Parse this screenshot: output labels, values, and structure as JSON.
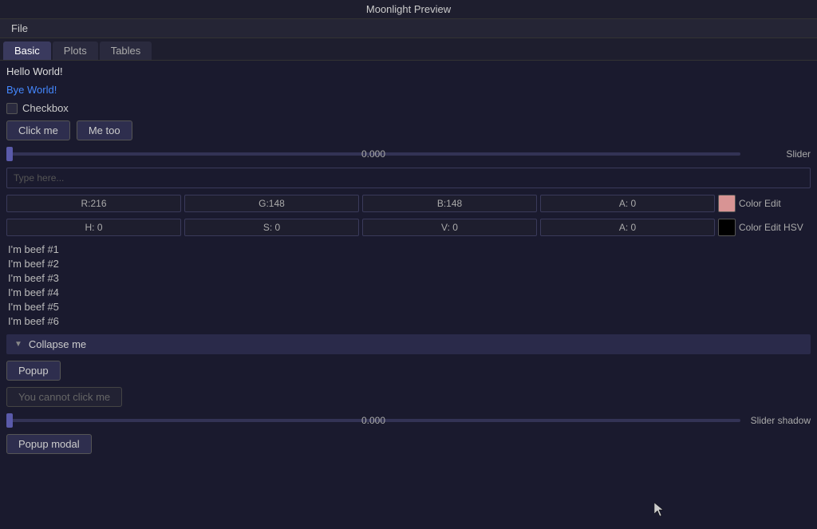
{
  "titlebar": {
    "title": "Moonlight Preview"
  },
  "menubar": {
    "file_label": "File"
  },
  "tabs": {
    "items": [
      {
        "label": "Basic",
        "active": true
      },
      {
        "label": "Plots",
        "active": false
      },
      {
        "label": "Tables",
        "active": false
      }
    ]
  },
  "content": {
    "hello": "Hello World!",
    "bye": "Bye World!",
    "checkbox_label": "Checkbox",
    "btn_click_me": "Click me",
    "btn_me_too": "Me too",
    "slider1": {
      "value": "0.000",
      "label": "Slider"
    },
    "text_input_placeholder": "Type here...",
    "color_edit": {
      "r": "R:216",
      "g": "G:148",
      "b": "B:148",
      "a": "A: 0",
      "label": "Color Edit",
      "swatch_color": "#d89494"
    },
    "color_edit_hsv": {
      "h": "H: 0",
      "s": "S: 0",
      "v": "V: 0",
      "a": "A: 0",
      "label": "Color Edit HSV",
      "swatch_color": "#000000"
    },
    "list_items": [
      "I'm beef #1",
      "I'm beef #2",
      "I'm beef #3",
      "I'm beef #4",
      "I'm beef #5",
      "I'm beef #6"
    ],
    "collapse_label": "Collapse me",
    "popup_label": "Popup",
    "disabled_btn_label": "You cannot click me",
    "slider2": {
      "value": "0.000",
      "label": "Slider shadow"
    },
    "popup_modal_label": "Popup modal"
  }
}
